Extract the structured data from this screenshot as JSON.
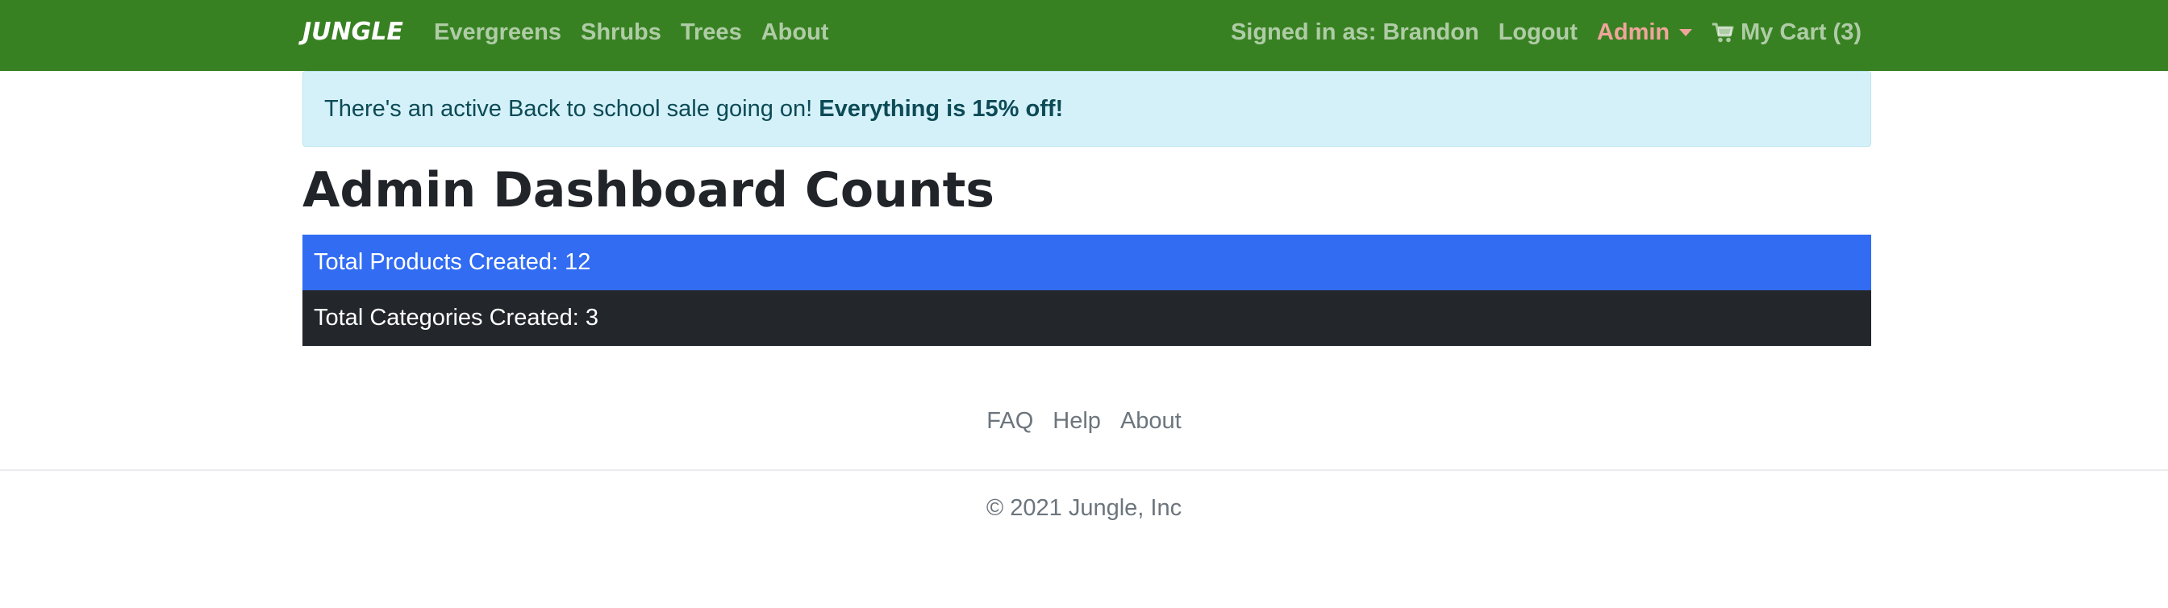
{
  "navbar": {
    "brand": "JUNGLE",
    "left_links": [
      {
        "label": "Evergreens"
      },
      {
        "label": "Shrubs"
      },
      {
        "label": "Trees"
      },
      {
        "label": "About"
      }
    ],
    "signed_in_text": "Signed in as: Brandon",
    "logout_label": "Logout",
    "admin_label": "Admin",
    "cart_label": "My Cart (3)",
    "cart_icon": "shopping-cart-icon",
    "colors": {
      "background": "#388122",
      "admin_accent": "#f0a59c"
    }
  },
  "alert": {
    "text": "There's an active Back to school sale going on!",
    "emphasis": "Everything is 15% off!"
  },
  "main": {
    "title": "Admin Dashboard Counts",
    "stats": [
      {
        "label": "Total Products Created: 12",
        "color": "#316cf2"
      },
      {
        "label": "Total Categories Created: 3",
        "color": "#23262b"
      }
    ]
  },
  "footer": {
    "links": [
      {
        "label": "FAQ"
      },
      {
        "label": "Help"
      },
      {
        "label": "About"
      }
    ],
    "copyright": "© 2021 Jungle, Inc"
  }
}
